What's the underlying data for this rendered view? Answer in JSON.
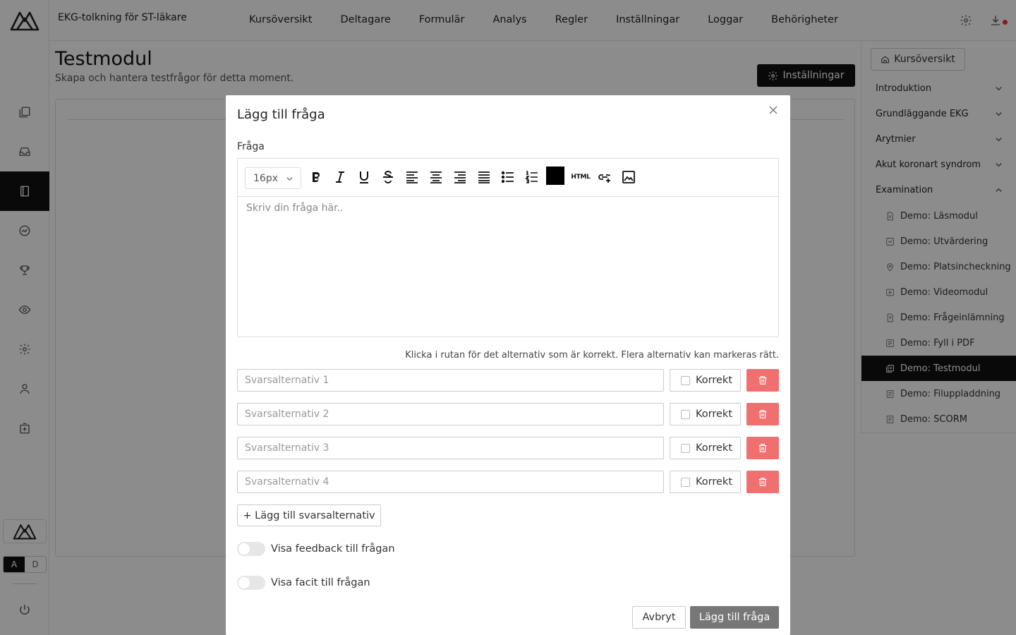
{
  "app": {
    "course_title": "EKG-tolkning för ST-läkare"
  },
  "topnav": [
    "Kursöversikt",
    "Deltagare",
    "Formulär",
    "Analys",
    "Regler",
    "Inställningar",
    "Loggar",
    "Behörigheter"
  ],
  "rail": {
    "icons": [
      "modules-icon",
      "inbox-icon",
      "book-icon",
      "chart-icon",
      "trophy-icon",
      "eye-icon",
      "gear-icon",
      "user-icon",
      "add-box-icon"
    ],
    "active_index": 2,
    "mode_a": "A",
    "mode_d": "D",
    "active_mode": "A"
  },
  "page": {
    "title": "Testmodul",
    "subtitle": "Skapa och hantera testfrågor för detta moment.",
    "settings_label": "Inställningar"
  },
  "right_panel": {
    "overview_label": "Kursöversikt",
    "sections": [
      {
        "label": "Introduktion",
        "expanded": false
      },
      {
        "label": "Grundläggande EKG",
        "expanded": false
      },
      {
        "label": "Arytmier",
        "expanded": false
      },
      {
        "label": "Akut koronart syndrom",
        "expanded": false
      },
      {
        "label": "Examination",
        "expanded": true
      }
    ],
    "items": [
      {
        "label": "Demo: Läsmodul",
        "icon": "document-icon",
        "active": false
      },
      {
        "label": "Demo: Utvärdering",
        "icon": "survey-icon",
        "active": false
      },
      {
        "label": "Demo: Platsincheckning",
        "icon": "location-pin-icon",
        "active": false
      },
      {
        "label": "Demo: Videomodul",
        "icon": "video-icon",
        "active": false
      },
      {
        "label": "Demo: Frågeinlämning",
        "icon": "file-question-icon",
        "active": false
      },
      {
        "label": "Demo: Fyll i PDF",
        "icon": "pdf-icon",
        "active": false
      },
      {
        "label": "Demo: Testmodul",
        "icon": "test-icon",
        "active": true
      },
      {
        "label": "Demo: Filuppladdning",
        "icon": "upload-doc-icon",
        "active": false
      },
      {
        "label": "Demo: SCORM",
        "icon": "scorm-icon",
        "active": false
      }
    ]
  },
  "modal": {
    "title": "Lägg till fråga",
    "question_label": "Fråga",
    "font_size": "16px",
    "editor_placeholder": "Skriv din fråga här..",
    "toolbar": [
      "bold-icon",
      "italic-icon",
      "underline-icon",
      "strikethrough-icon",
      "align-left-icon",
      "align-center-icon",
      "align-right-icon",
      "align-justify-icon",
      "bullet-list-icon",
      "numbered-list-icon",
      "text-color-swatch",
      "html-icon",
      "insert-link-icon",
      "insert-image-icon"
    ],
    "text_color": "#000000",
    "html_label": "HTML",
    "hint": "Klicka i rutan för det alternativ som är korrekt. Flera alternativ kan markeras rätt.",
    "answers": [
      {
        "placeholder": "Svarsalternativ 1",
        "correct_label": "Korrekt",
        "checked": false
      },
      {
        "placeholder": "Svarsalternativ 2",
        "correct_label": "Korrekt",
        "checked": false
      },
      {
        "placeholder": "Svarsalternativ 3",
        "correct_label": "Korrekt",
        "checked": false
      },
      {
        "placeholder": "Svarsalternativ 4",
        "correct_label": "Korrekt",
        "checked": false
      }
    ],
    "add_option_label": "+ Lägg till svarsalternativ",
    "toggles": [
      {
        "label": "Visa feedback till frågan",
        "on": false
      },
      {
        "label": "Visa facit till frågan",
        "on": false
      }
    ],
    "cancel_label": "Avbryt",
    "submit_label": "Lägg till fråga"
  },
  "colors": {
    "delete": "#f07070",
    "primary_dark": "#111111",
    "submit_disabled": "#777777",
    "notification_dot": "#e53935"
  }
}
